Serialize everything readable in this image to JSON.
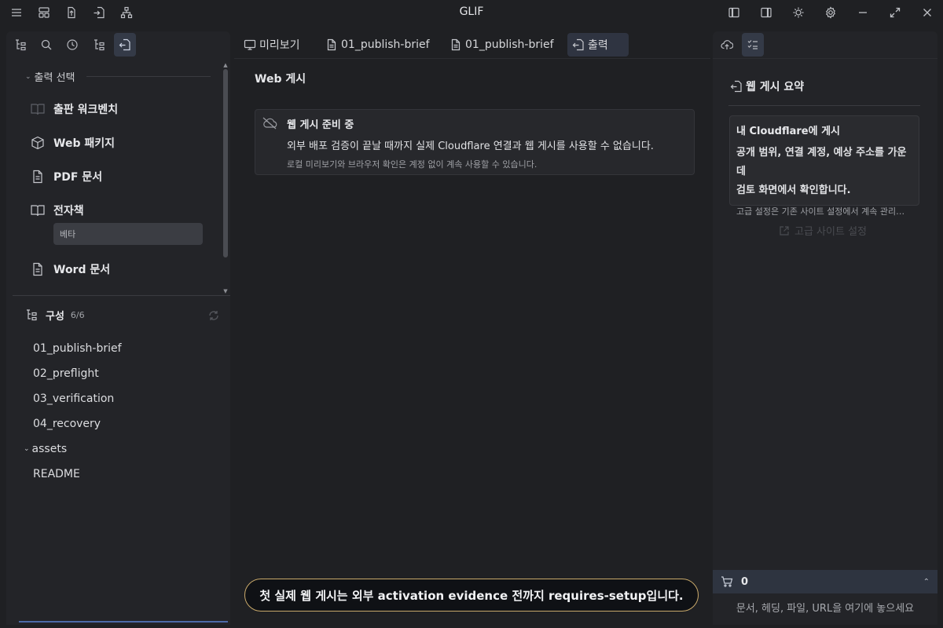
{
  "app": {
    "title": "GLIF"
  },
  "titlebar_icons": [
    "menu-icon",
    "layout-icon",
    "export-icon",
    "import-icon",
    "sitemap-icon",
    "left-sidebar-icon",
    "right-sidebar-icon",
    "theme-icon",
    "settings-icon",
    "minimize-icon",
    "maximize-icon",
    "close-icon"
  ],
  "left_tabs": [
    "outline-icon",
    "search-icon",
    "history-icon",
    "tree-icon",
    "output-icon"
  ],
  "output": {
    "section_title": "출력 선택",
    "items": [
      {
        "label": "출판 워크벤치",
        "icon": "book-open-icon"
      },
      {
        "label": "Web 패키지",
        "icon": "package-icon"
      },
      {
        "label": "PDF 문서",
        "icon": "document-icon"
      },
      {
        "label": "전자책",
        "icon": "book-icon"
      },
      {
        "label": "Word 문서",
        "icon": "document-icon"
      }
    ],
    "ebook_badge": "베타"
  },
  "composition": {
    "title": "구성",
    "count": "6/6",
    "items": [
      "01_publish-brief",
      "02_preflight",
      "03_verification",
      "04_recovery"
    ],
    "folder": "assets",
    "last_item": "README"
  },
  "center": {
    "tabs": [
      {
        "label": "미리보기",
        "icon": "monitor-icon"
      },
      {
        "label": "01_publish-brief",
        "icon": "file-icon"
      },
      {
        "label": "01_publish-brief",
        "icon": "file-icon"
      },
      {
        "label": "출력",
        "icon": "output-icon"
      }
    ],
    "heading": "Web 게시",
    "notice": {
      "title": "웹 게시 준비 중",
      "body": "외부 배포 검증이 끝날 때까지 실제 Cloudflare 연결과 웹 게시를 사용할 수 없습니다.",
      "sub": "로컬 미리보기와 브라우저 확인은 계정 없이 계속 사용할 수 있습니다."
    },
    "toast": "첫 실제 웹 게시는 외부 activation evidence 전까지 requires-setup입니다."
  },
  "right": {
    "tabs": [
      "upload-icon",
      "checklist-icon"
    ],
    "summary_title": "웹 게시 요약",
    "card": {
      "title": "내 Cloudflare에 게시",
      "body_line1": "공개 범위, 연결 계정, 예상 주소를 가운데",
      "body_line2": "검토 화면에서 확인합니다.",
      "note": "고급 설정은 기존 사이트 설정에서 계속 관리합니다."
    },
    "advanced_link": "고급 사이트 설정",
    "cart_count": "0",
    "drop_hint": "문서, 헤딩, 파일, URL을 여기에 놓으세요"
  },
  "colors": {
    "accent": "#343a47",
    "toast_border": "#c9a96a",
    "bg": "#1f2023"
  }
}
